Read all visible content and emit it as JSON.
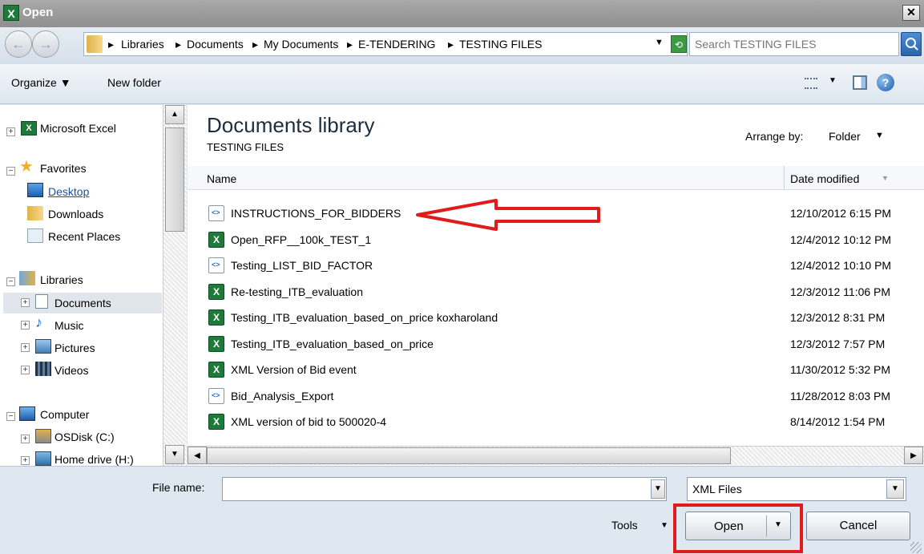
{
  "window": {
    "title": "Open",
    "app_icon": "X"
  },
  "address": {
    "crumbs": [
      "Libraries",
      "Documents",
      "My Documents",
      "E-TENDERING",
      "TESTING FILES"
    ],
    "search_placeholder": "Search TESTING FILES"
  },
  "toolbar": {
    "organize": "Organize",
    "new_folder": "New folder"
  },
  "nav": {
    "items": [
      {
        "label": "Microsoft Excel",
        "icon": "excel-icon"
      },
      {
        "label": "Favorites",
        "icon": "star-icon"
      },
      {
        "label": "Desktop",
        "icon": "desktop-icon"
      },
      {
        "label": "Downloads",
        "icon": "downloads-folder-icon"
      },
      {
        "label": "Recent Places",
        "icon": "recent-places-icon"
      },
      {
        "label": "Libraries",
        "icon": "libraries-icon"
      },
      {
        "label": "Documents",
        "icon": "documents-icon"
      },
      {
        "label": "Music",
        "icon": "music-icon"
      },
      {
        "label": "Pictures",
        "icon": "pictures-icon"
      },
      {
        "label": "Videos",
        "icon": "videos-icon"
      },
      {
        "label": "Computer",
        "icon": "computer-icon"
      },
      {
        "label": "OSDisk (C:)",
        "icon": "disk-icon"
      },
      {
        "label": "Home drive (H:)",
        "icon": "network-drive-icon"
      }
    ]
  },
  "library": {
    "title": "Documents library",
    "subtitle": "TESTING FILES",
    "arrange_label": "Arrange by:",
    "arrange_value": "Folder"
  },
  "columns": {
    "name": "Name",
    "date": "Date modified"
  },
  "files": [
    {
      "name": "INSTRUCTIONS_FOR_BIDDERS",
      "date": "12/10/2012 6:15 PM",
      "type": "xml"
    },
    {
      "name": "Open_RFP__100k_TEST_1",
      "date": "12/4/2012 10:12 PM",
      "type": "xls"
    },
    {
      "name": "Testing_LIST_BID_FACTOR",
      "date": "12/4/2012 10:10 PM",
      "type": "xml"
    },
    {
      "name": "Re-testing_ITB_evaluation",
      "date": "12/3/2012 11:06 PM",
      "type": "xls"
    },
    {
      "name": "Testing_ITB_evaluation_based_on_price koxharoland",
      "date": "12/3/2012 8:31 PM",
      "type": "xls"
    },
    {
      "name": "Testing_ITB_evaluation_based_on_price",
      "date": "12/3/2012 7:57 PM",
      "type": "xls"
    },
    {
      "name": "XML Version of Bid event",
      "date": "11/30/2012 5:32 PM",
      "type": "xls"
    },
    {
      "name": "Bid_Analysis_Export",
      "date": "11/28/2012 8:03 PM",
      "type": "xml"
    },
    {
      "name": "XML version of bid to 500020-4",
      "date": "8/14/2012 1:54 PM",
      "type": "xls"
    }
  ],
  "footer": {
    "file_name_label": "File name:",
    "file_name_value": "",
    "file_type": "XML Files",
    "tools": "Tools",
    "open": "Open",
    "cancel": "Cancel"
  },
  "colors": {
    "annotation": "#e01b1b",
    "link": "#1f4e9c"
  }
}
